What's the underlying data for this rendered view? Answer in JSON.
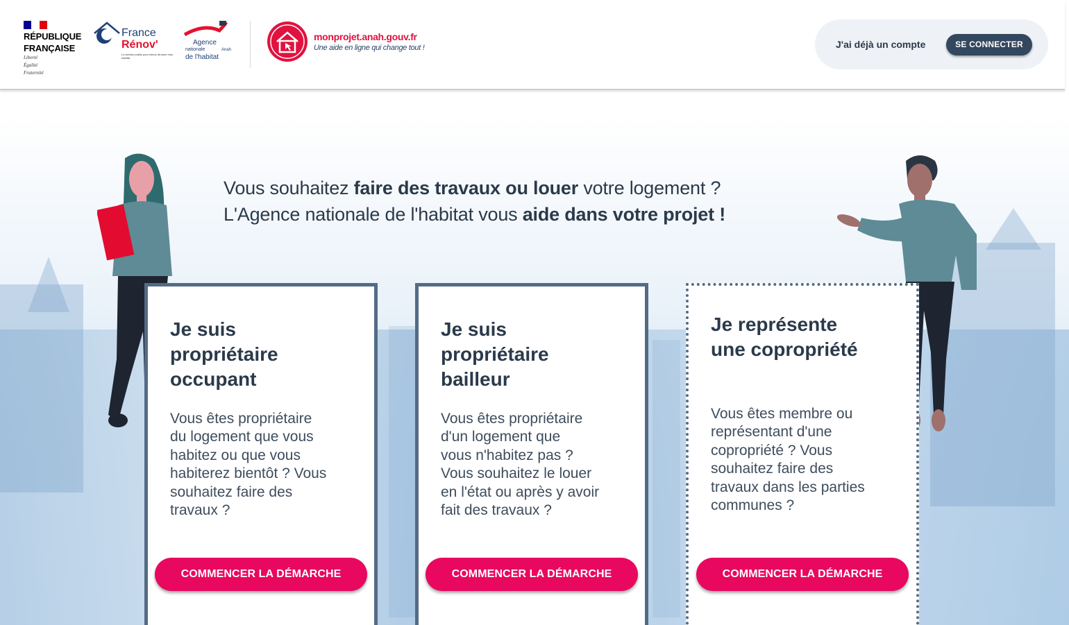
{
  "header": {
    "republique": {
      "line1": "RÉPUBLIQUE",
      "line2": "FRANÇAISE",
      "motto1": "Liberté",
      "motto2": "Égalité",
      "motto3": "Fraternité"
    },
    "france_renov": {
      "word1": "France",
      "word2": "Rénov'",
      "tagline": "Le service public pour mieux rénover mon habitat"
    },
    "anah": {
      "line1": "Agence",
      "line2": "nationale",
      "line3": "de l'habitat",
      "acronym": "Anah"
    },
    "site": {
      "url": "monprojet.anah.gouv.fr",
      "tagline": "Une aide en ligne qui change tout !"
    },
    "account": {
      "label": "J'ai déjà un compte",
      "login_button": "SE CONNECTER"
    },
    "colors": {
      "blue": "#000091",
      "red": "#e1000f",
      "pink": "#e8085f",
      "navy": "#33475e"
    }
  },
  "hero": {
    "line1_pre": "Vous souhaitez ",
    "line1_bold": "faire des travaux ou louer",
    "line1_post": " votre logement ?",
    "line2_pre": "L'Agence nationale de l'habitat vous ",
    "line2_bold": "aide dans votre projet !"
  },
  "cards": [
    {
      "title_l1": "Je suis",
      "title_l2": "propriétaire",
      "title_l3": "occupant",
      "text": [
        "Vous êtes propriétaire",
        "du logement que vous",
        "habitez ou que vous",
        "habiterez bientôt ? Vous",
        "souhaitez faire des",
        "travaux ?"
      ],
      "cta": "COMMENCER LA DÉMARCHE"
    },
    {
      "title_l1": "Je suis",
      "title_l2": "propriétaire",
      "title_l3": "bailleur",
      "text": [
        "Vous êtes propriétaire",
        "d'un logement que",
        "vous n'habitez pas ?",
        "Vous souhaitez le louer",
        "en l'état ou après y avoir",
        "fait des travaux ?"
      ],
      "cta": "COMMENCER LA DÉMARCHE"
    },
    {
      "title_l1": "Je représente",
      "title_l2": "une copropriété",
      "text": [
        "Vous êtes membre ou",
        "représentant d'une",
        "copropriété ? Vous",
        "souhaitez faire des",
        "travaux dans les parties",
        "communes ?"
      ],
      "cta": "COMMENCER LA DÉMARCHE"
    }
  ]
}
